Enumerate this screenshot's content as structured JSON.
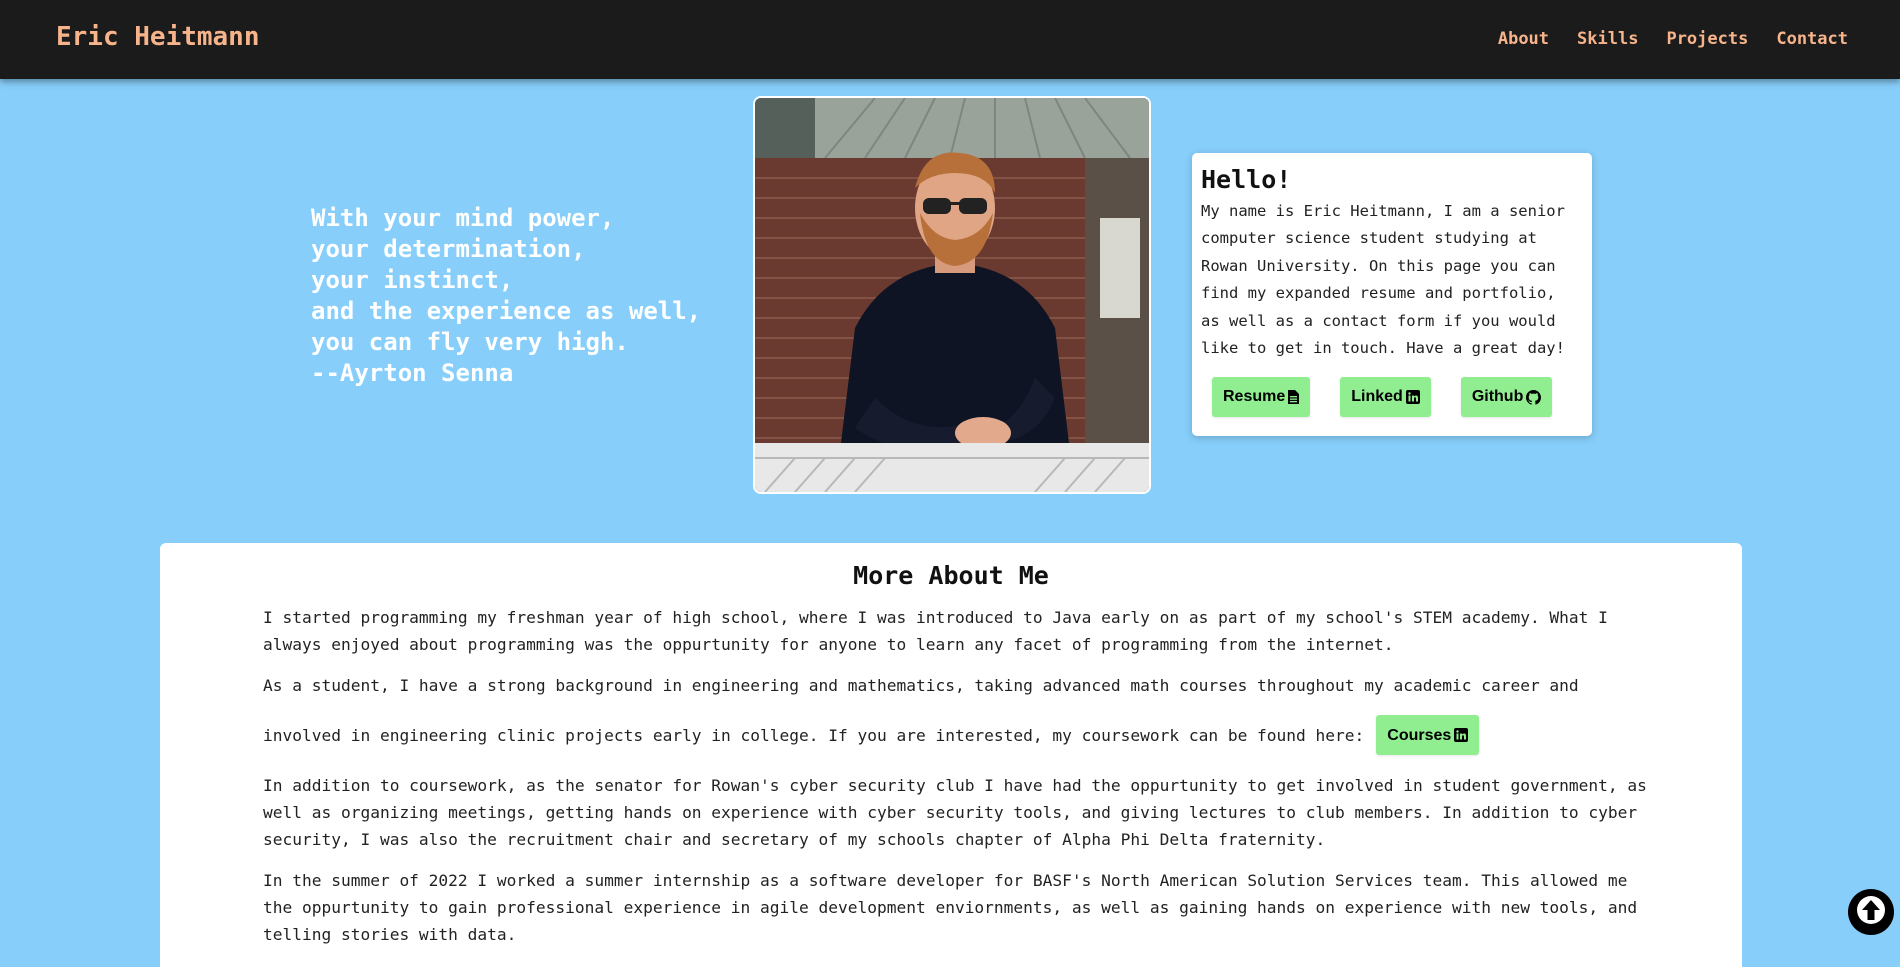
{
  "nav": {
    "brand": "Eric Heitmann",
    "links": [
      "About",
      "Skills",
      "Projects",
      "Contact"
    ]
  },
  "hero": {
    "quote_lines": [
      "With your mind power,",
      "your determination,",
      "your instinct,",
      "and the experience as well,",
      "you can fly very high.",
      "--Ayrton Senna"
    ]
  },
  "hello": {
    "title": "Hello!",
    "lines": [
      "My name is Eric Heitmann, I am a senior",
      "computer science student studying at",
      "Rowan University. On this page you can",
      "find my expanded resume and portfolio,",
      "as well as a contact form if you would",
      "like to get in touch. Have a great day!"
    ],
    "buttons": [
      {
        "label": "Resume",
        "icon": "file-icon"
      },
      {
        "label": "Linked",
        "icon": "linkedin-icon"
      },
      {
        "label": "Github",
        "icon": "github-icon"
      }
    ]
  },
  "about": {
    "title": "More About Me",
    "p1": [
      "I started programming my freshman year of high school, where I was introduced to Java early on as part of my school's STEM academy. What I",
      "always enjoyed about programming was the oppurtunity for anyone to learn any facet of programming from the internet."
    ],
    "p2_line1": "As a student, I have a strong background in engineering and mathematics, taking advanced math courses throughout my academic career and",
    "p2_line2": "involved in engineering clinic projects early in college. If you are interested, my coursework can be found here:",
    "courses_button": "Courses",
    "p3": [
      "In addition to coursework, as the senator for Rowan's cyber security club I have had the oppurtunity to get involved in student government, as",
      "well as organizing meetings, getting hands on experience with cyber security tools, and giving lectures to club members. In addition to cyber",
      "security, I was also the recruitment chair and secretary of my schools chapter of Alpha Phi Delta fraternity."
    ],
    "p4": [
      "In the summer of 2022 I worked a summer internship as a software developer for BASF's North American Solution Services team. This allowed me",
      "the oppurtunity to gain professional experience in agile development enviornments, as well as gaining hands on experience with new tools, and",
      "telling stories with data."
    ]
  },
  "colors": {
    "background": "#87cefa",
    "nav_bg": "#1b1b1b",
    "nav_text": "#f7b48b",
    "button_bg": "#90ee90"
  }
}
